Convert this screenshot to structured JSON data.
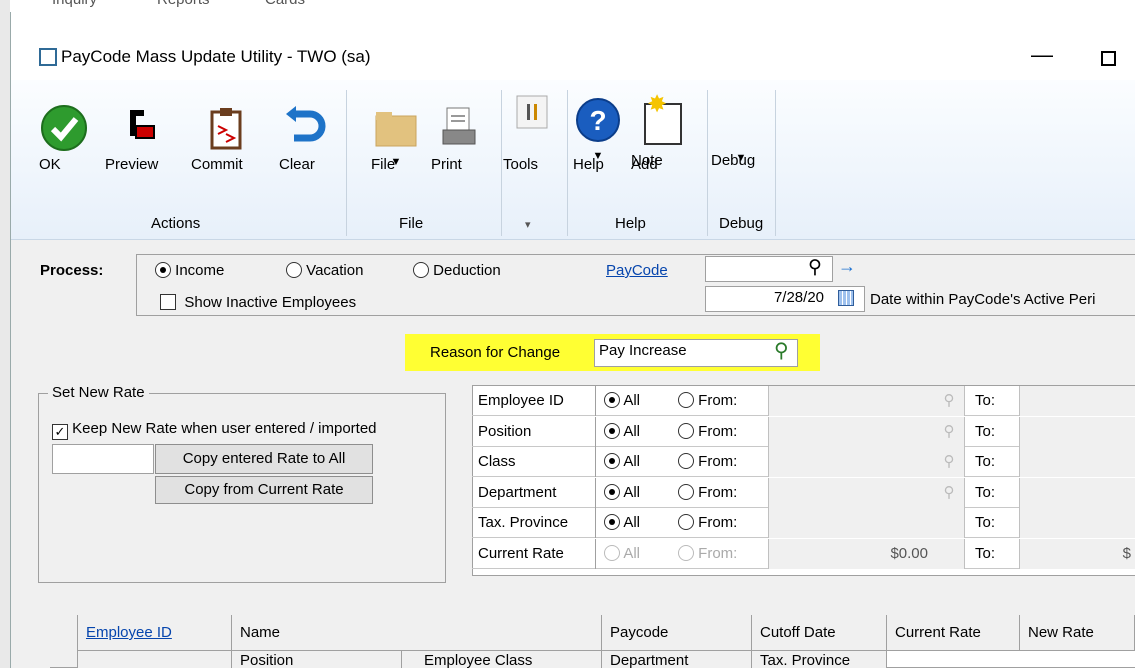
{
  "top_menu": [
    "Inquiry",
    "Reports",
    "Cards"
  ],
  "window": {
    "title": "PayCode Mass Update Utility  -  TWO (sa)",
    "min_glyph": "—"
  },
  "ribbon": {
    "buttons": {
      "ok": "OK",
      "preview": "Preview",
      "commit": "Commit",
      "clear": "Clear",
      "file": "File",
      "print": "Print",
      "tools": "Tools",
      "help": "Help",
      "add_note_1": "Add",
      "add_note_2": "Note",
      "debug": "Debug"
    },
    "groups": {
      "actions": "Actions",
      "file": "File",
      "tools": "▾",
      "help": "Help",
      "debug": "Debug"
    }
  },
  "process": {
    "label": "Process:",
    "options": [
      "Income",
      "Vacation",
      "Deduction"
    ],
    "selected": "Income",
    "show_inactive": "Show Inactive Employees",
    "paycode_link": "PayCode",
    "paycode_value": "",
    "date_value": "7/28/20",
    "date_hint": "Date within PayCode's Active Peri"
  },
  "reason": {
    "label": "Reason for Change",
    "value": "Pay Increase"
  },
  "set_new_rate": {
    "title": "Set New Rate",
    "keep_label": "Keep New Rate when user entered / imported",
    "keep_checked": "✓",
    "rate_value": "",
    "copy_entered": "Copy entered Rate to All",
    "copy_current": "Copy from Current Rate"
  },
  "filters": [
    {
      "label": "Employee ID",
      "all": "All",
      "from": "From:",
      "to": "To:",
      "from_value": "",
      "to_value": ""
    },
    {
      "label": "Position",
      "all": "All",
      "from": "From:",
      "to": "To:",
      "from_value": "",
      "to_value": ""
    },
    {
      "label": "Class",
      "all": "All",
      "from": "From:",
      "to": "To:",
      "from_value": "",
      "to_value": ""
    },
    {
      "label": "Department",
      "all": "All",
      "from": "From:",
      "to": "To:",
      "from_value": "",
      "to_value": ""
    },
    {
      "label": "Tax. Province",
      "all": "All",
      "from": "From:",
      "to": "To:",
      "from_value": "",
      "to_value": ""
    },
    {
      "label": "Current Rate",
      "all": "All",
      "from": "From:",
      "to": "To:",
      "from_value": "$0.00",
      "to_value": "$"
    }
  ],
  "grid": {
    "headers_row1": [
      "Employee ID",
      "Name",
      "Paycode",
      "Cutoff Date",
      "Current Rate",
      "New Rate"
    ],
    "headers_row2": [
      "Position",
      "Employee Class",
      "Department",
      "Tax. Province"
    ]
  },
  "colors": {
    "highlight": "#ffff33",
    "link": "#0645ad",
    "ribbon_bg": "#e7f0fa"
  }
}
